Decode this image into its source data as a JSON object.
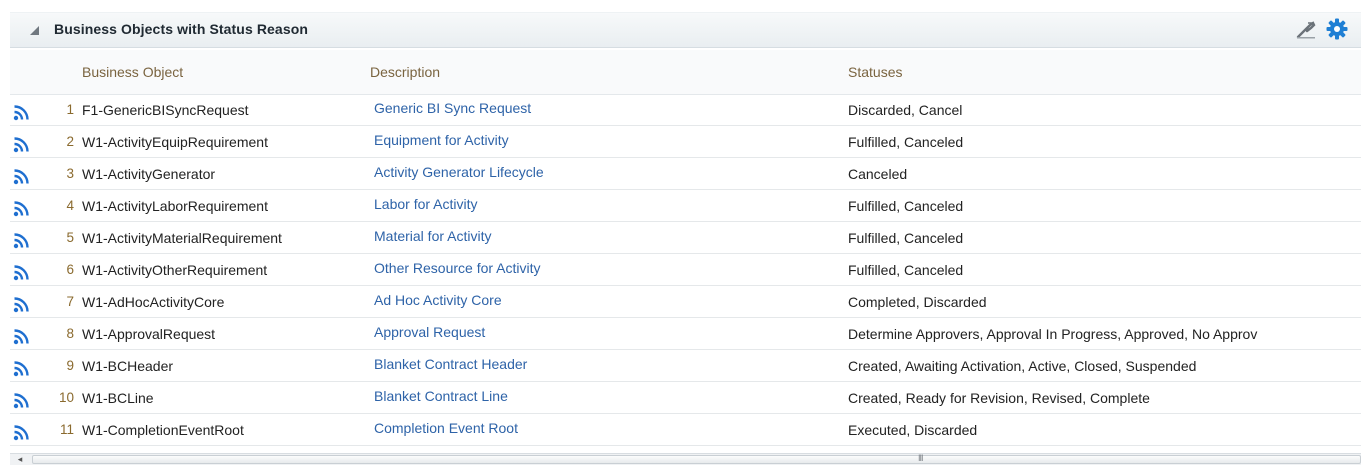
{
  "panel": {
    "title": "Business Objects with Status Reason"
  },
  "icons": {
    "collapse": "collapse-triangle-icon",
    "wrench": "wrench-icon",
    "gear": "gear-icon",
    "row": "rss-feed-icon"
  },
  "colors": {
    "link": "#2e63a8",
    "gear": "#1f7fd4",
    "rss": "#1f6fd0",
    "header_text": "#7a6440"
  },
  "table": {
    "columns": [
      "Business Object",
      "Description",
      "Statuses"
    ],
    "rows": [
      {
        "num": "1",
        "bo": "F1-GenericBISyncRequest",
        "desc": "Generic BI Sync Request",
        "statuses": "Discarded, Cancel"
      },
      {
        "num": "2",
        "bo": "W1-ActivityEquipRequirement",
        "desc": "Equipment for Activity",
        "statuses": "Fulfilled, Canceled"
      },
      {
        "num": "3",
        "bo": "W1-ActivityGenerator",
        "desc": "Activity Generator Lifecycle",
        "statuses": "Canceled"
      },
      {
        "num": "4",
        "bo": "W1-ActivityLaborRequirement",
        "desc": "Labor for Activity",
        "statuses": "Fulfilled, Canceled"
      },
      {
        "num": "5",
        "bo": "W1-ActivityMaterialRequirement",
        "desc": "Material for Activity",
        "statuses": "Fulfilled, Canceled"
      },
      {
        "num": "6",
        "bo": "W1-ActivityOtherRequirement",
        "desc": "Other Resource for Activity",
        "statuses": "Fulfilled, Canceled"
      },
      {
        "num": "7",
        "bo": "W1-AdHocActivityCore",
        "desc": "Ad Hoc Activity Core",
        "statuses": "Completed, Discarded"
      },
      {
        "num": "8",
        "bo": "W1-ApprovalRequest",
        "desc": "Approval Request",
        "statuses": "Determine Approvers, Approval In Progress, Approved, No Approv"
      },
      {
        "num": "9",
        "bo": "W1-BCHeader",
        "desc": "Blanket Contract Header",
        "statuses": "Created, Awaiting Activation, Active, Closed, Suspended"
      },
      {
        "num": "10",
        "bo": "W1-BCLine",
        "desc": "Blanket Contract Line",
        "statuses": "Created, Ready for Revision, Revised, Complete"
      },
      {
        "num": "11",
        "bo": "W1-CompletionEventRoot",
        "desc": "Completion Event Root",
        "statuses": "Executed, Discarded"
      }
    ]
  },
  "scrollbar": {
    "left_arrow": "◂",
    "grip": "III"
  }
}
